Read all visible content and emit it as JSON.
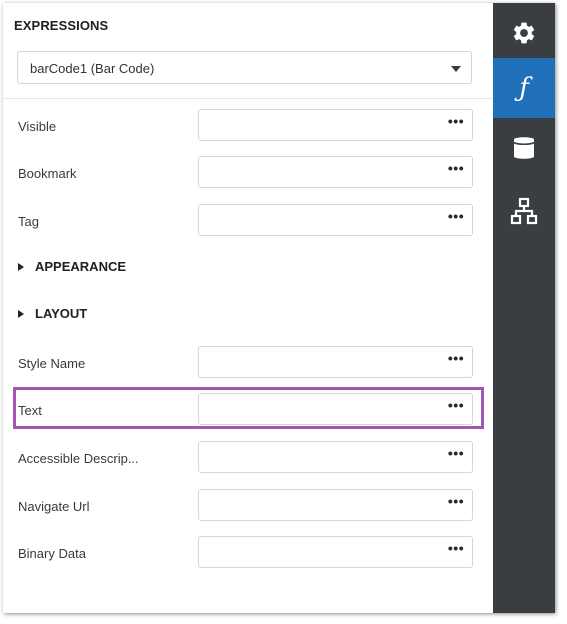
{
  "panel": {
    "title": "EXPRESSIONS",
    "selector": {
      "value": "barCode1 (Bar Code)"
    }
  },
  "properties": [
    {
      "label": "Visible",
      "value": "",
      "button": "•••"
    },
    {
      "label": "Bookmark",
      "value": "",
      "button": "•••"
    },
    {
      "label": "Tag",
      "value": "",
      "button": "•••"
    }
  ],
  "sections": [
    {
      "label": "APPEARANCE"
    },
    {
      "label": "LAYOUT"
    }
  ],
  "layout_properties": [
    {
      "label": "Style Name",
      "value": "",
      "button": "•••"
    },
    {
      "label": "Text",
      "value": "",
      "button": "•••"
    },
    {
      "label": "Accessible Descrip...",
      "value": "",
      "button": "•••"
    },
    {
      "label": "Navigate Url",
      "value": "",
      "button": "•••"
    },
    {
      "label": "Binary Data",
      "value": "",
      "button": "•••"
    }
  ],
  "sidebar": {
    "tabs": [
      {
        "icon": "gear-icon",
        "active": false
      },
      {
        "icon": "function-icon",
        "glyph": "ƒ",
        "active": true
      },
      {
        "icon": "database-icon",
        "active": false
      },
      {
        "icon": "hierarchy-icon",
        "active": false
      }
    ]
  },
  "colors": {
    "accent": "#1f6fb9",
    "sidebar": "#3a3e43",
    "highlight": "#a455b2"
  }
}
